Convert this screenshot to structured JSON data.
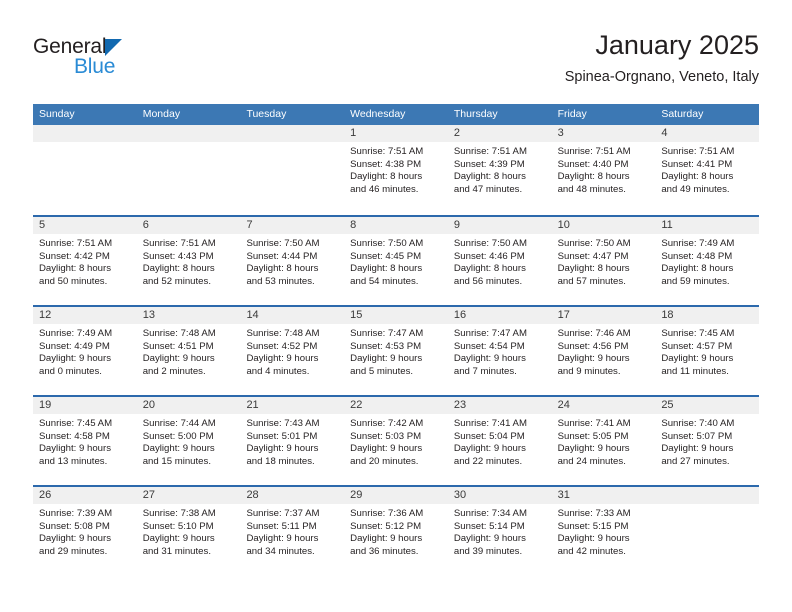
{
  "brand": {
    "name_part1": "General",
    "name_part2": "Blue",
    "triangle_color": "#1269b0",
    "part2_color": "#2a8bd5"
  },
  "header": {
    "month_title": "January 2025",
    "location": "Spinea-Orgnano, Veneto, Italy"
  },
  "theme": {
    "header_bg": "#3c78b4",
    "row_divider": "#2c69ac",
    "daynum_band": "#f0f0f0"
  },
  "weekday_headers": [
    "Sunday",
    "Monday",
    "Tuesday",
    "Wednesday",
    "Thursday",
    "Friday",
    "Saturday"
  ],
  "weeks": [
    [
      {
        "day": "",
        "lines": []
      },
      {
        "day": "",
        "lines": []
      },
      {
        "day": "",
        "lines": []
      },
      {
        "day": "1",
        "lines": [
          "Sunrise: 7:51 AM",
          "Sunset: 4:38 PM",
          "Daylight: 8 hours",
          "and 46 minutes."
        ]
      },
      {
        "day": "2",
        "lines": [
          "Sunrise: 7:51 AM",
          "Sunset: 4:39 PM",
          "Daylight: 8 hours",
          "and 47 minutes."
        ]
      },
      {
        "day": "3",
        "lines": [
          "Sunrise: 7:51 AM",
          "Sunset: 4:40 PM",
          "Daylight: 8 hours",
          "and 48 minutes."
        ]
      },
      {
        "day": "4",
        "lines": [
          "Sunrise: 7:51 AM",
          "Sunset: 4:41 PM",
          "Daylight: 8 hours",
          "and 49 minutes."
        ]
      }
    ],
    [
      {
        "day": "5",
        "lines": [
          "Sunrise: 7:51 AM",
          "Sunset: 4:42 PM",
          "Daylight: 8 hours",
          "and 50 minutes."
        ]
      },
      {
        "day": "6",
        "lines": [
          "Sunrise: 7:51 AM",
          "Sunset: 4:43 PM",
          "Daylight: 8 hours",
          "and 52 minutes."
        ]
      },
      {
        "day": "7",
        "lines": [
          "Sunrise: 7:50 AM",
          "Sunset: 4:44 PM",
          "Daylight: 8 hours",
          "and 53 minutes."
        ]
      },
      {
        "day": "8",
        "lines": [
          "Sunrise: 7:50 AM",
          "Sunset: 4:45 PM",
          "Daylight: 8 hours",
          "and 54 minutes."
        ]
      },
      {
        "day": "9",
        "lines": [
          "Sunrise: 7:50 AM",
          "Sunset: 4:46 PM",
          "Daylight: 8 hours",
          "and 56 minutes."
        ]
      },
      {
        "day": "10",
        "lines": [
          "Sunrise: 7:50 AM",
          "Sunset: 4:47 PM",
          "Daylight: 8 hours",
          "and 57 minutes."
        ]
      },
      {
        "day": "11",
        "lines": [
          "Sunrise: 7:49 AM",
          "Sunset: 4:48 PM",
          "Daylight: 8 hours",
          "and 59 minutes."
        ]
      }
    ],
    [
      {
        "day": "12",
        "lines": [
          "Sunrise: 7:49 AM",
          "Sunset: 4:49 PM",
          "Daylight: 9 hours",
          "and 0 minutes."
        ]
      },
      {
        "day": "13",
        "lines": [
          "Sunrise: 7:48 AM",
          "Sunset: 4:51 PM",
          "Daylight: 9 hours",
          "and 2 minutes."
        ]
      },
      {
        "day": "14",
        "lines": [
          "Sunrise: 7:48 AM",
          "Sunset: 4:52 PM",
          "Daylight: 9 hours",
          "and 4 minutes."
        ]
      },
      {
        "day": "15",
        "lines": [
          "Sunrise: 7:47 AM",
          "Sunset: 4:53 PM",
          "Daylight: 9 hours",
          "and 5 minutes."
        ]
      },
      {
        "day": "16",
        "lines": [
          "Sunrise: 7:47 AM",
          "Sunset: 4:54 PM",
          "Daylight: 9 hours",
          "and 7 minutes."
        ]
      },
      {
        "day": "17",
        "lines": [
          "Sunrise: 7:46 AM",
          "Sunset: 4:56 PM",
          "Daylight: 9 hours",
          "and 9 minutes."
        ]
      },
      {
        "day": "18",
        "lines": [
          "Sunrise: 7:45 AM",
          "Sunset: 4:57 PM",
          "Daylight: 9 hours",
          "and 11 minutes."
        ]
      }
    ],
    [
      {
        "day": "19",
        "lines": [
          "Sunrise: 7:45 AM",
          "Sunset: 4:58 PM",
          "Daylight: 9 hours",
          "and 13 minutes."
        ]
      },
      {
        "day": "20",
        "lines": [
          "Sunrise: 7:44 AM",
          "Sunset: 5:00 PM",
          "Daylight: 9 hours",
          "and 15 minutes."
        ]
      },
      {
        "day": "21",
        "lines": [
          "Sunrise: 7:43 AM",
          "Sunset: 5:01 PM",
          "Daylight: 9 hours",
          "and 18 minutes."
        ]
      },
      {
        "day": "22",
        "lines": [
          "Sunrise: 7:42 AM",
          "Sunset: 5:03 PM",
          "Daylight: 9 hours",
          "and 20 minutes."
        ]
      },
      {
        "day": "23",
        "lines": [
          "Sunrise: 7:41 AM",
          "Sunset: 5:04 PM",
          "Daylight: 9 hours",
          "and 22 minutes."
        ]
      },
      {
        "day": "24",
        "lines": [
          "Sunrise: 7:41 AM",
          "Sunset: 5:05 PM",
          "Daylight: 9 hours",
          "and 24 minutes."
        ]
      },
      {
        "day": "25",
        "lines": [
          "Sunrise: 7:40 AM",
          "Sunset: 5:07 PM",
          "Daylight: 9 hours",
          "and 27 minutes."
        ]
      }
    ],
    [
      {
        "day": "26",
        "lines": [
          "Sunrise: 7:39 AM",
          "Sunset: 5:08 PM",
          "Daylight: 9 hours",
          "and 29 minutes."
        ]
      },
      {
        "day": "27",
        "lines": [
          "Sunrise: 7:38 AM",
          "Sunset: 5:10 PM",
          "Daylight: 9 hours",
          "and 31 minutes."
        ]
      },
      {
        "day": "28",
        "lines": [
          "Sunrise: 7:37 AM",
          "Sunset: 5:11 PM",
          "Daylight: 9 hours",
          "and 34 minutes."
        ]
      },
      {
        "day": "29",
        "lines": [
          "Sunrise: 7:36 AM",
          "Sunset: 5:12 PM",
          "Daylight: 9 hours",
          "and 36 minutes."
        ]
      },
      {
        "day": "30",
        "lines": [
          "Sunrise: 7:34 AM",
          "Sunset: 5:14 PM",
          "Daylight: 9 hours",
          "and 39 minutes."
        ]
      },
      {
        "day": "31",
        "lines": [
          "Sunrise: 7:33 AM",
          "Sunset: 5:15 PM",
          "Daylight: 9 hours",
          "and 42 minutes."
        ]
      },
      {
        "day": "",
        "lines": []
      }
    ]
  ]
}
